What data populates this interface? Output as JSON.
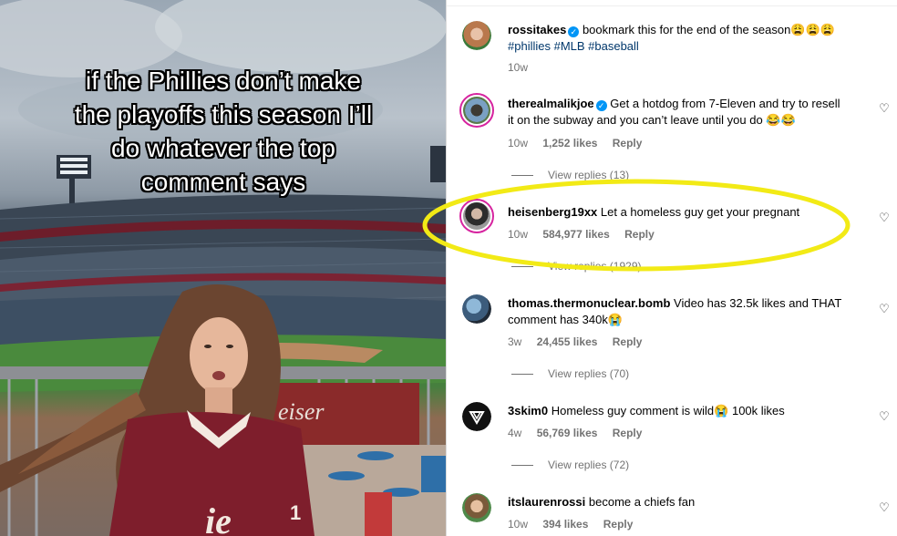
{
  "media": {
    "caption_lines": [
      "if the Phillies don’t make",
      "the playoffs this season I’ll",
      "do whatever the top",
      "comment says"
    ],
    "jersey_text": "ie",
    "jersey_number": "1",
    "sign_text": "eiser"
  },
  "post": {
    "username": "rossitakes",
    "text": "bookmark this for the end of the season😩😩😩",
    "tags": "#phillies #MLB #baseball",
    "time": "10w"
  },
  "comments": [
    {
      "username": "therealmalikjoe",
      "verified": true,
      "text_line1": "Get a hotdog from 7-Eleven and try to resell",
      "text_line2": "it on the subway and you can’t leave until you do 😂😂",
      "time": "10w",
      "likes": "1,252 likes",
      "reply": "Reply",
      "view_replies": "View replies (13)"
    },
    {
      "username": "heisenberg19xx",
      "text": "Let a homeless guy get your pregnant",
      "time": "10w",
      "likes": "584,977 likes",
      "reply": "Reply",
      "view_replies": "View replies (1929)"
    },
    {
      "username": "thomas.thermonuclear.bomb",
      "text_line1": "Video has 32.5k likes and THAT",
      "text_line2": "comment has 340k😭",
      "time": "3w",
      "likes": "24,455 likes",
      "reply": "Reply",
      "view_replies": "View replies (70)"
    },
    {
      "username": "3skim0",
      "text": "Homeless guy comment is wild😭  100k likes",
      "time": "4w",
      "likes": "56,769 likes",
      "reply": "Reply",
      "view_replies": "View replies (72)"
    },
    {
      "username": "itslaurenrossi",
      "text": "become a chiefs fan",
      "time": "10w",
      "likes": "394 likes",
      "reply": "Reply"
    }
  ],
  "icons": {
    "heart": "♡",
    "verified": "✓"
  },
  "colors": {
    "highlight": "#f2ea16",
    "verified": "#0095f6",
    "story_ring": "#d6249f",
    "meta_text": "#737373"
  }
}
